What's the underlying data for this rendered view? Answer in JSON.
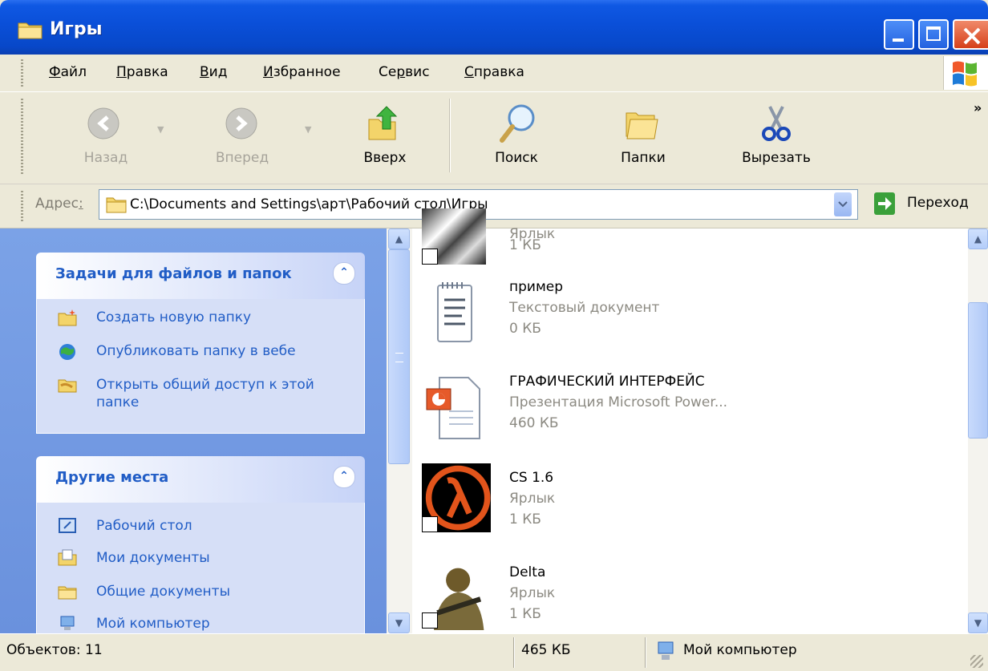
{
  "window": {
    "title": "Игры"
  },
  "menu": [
    {
      "hot": "Ф",
      "rest": "айл"
    },
    {
      "hot": "П",
      "rest": "равка"
    },
    {
      "hot": "В",
      "rest": "ид"
    },
    {
      "hot": "И",
      "rest": "збранное"
    },
    {
      "pre": "Се",
      "hot": "р",
      "rest": "вис"
    },
    {
      "hot": "С",
      "rest": "правка"
    }
  ],
  "toolbar": {
    "back": "Назад",
    "forward": "Вперед",
    "up": "Вверх",
    "search": "Поиск",
    "folders": "Папки",
    "cut": "Вырезать",
    "more": "»"
  },
  "address": {
    "label_pre": "Адрес",
    "label_hot": ":",
    "path": "C:\\Documents and Settings\\арт\\Рабочий стол\\Игры",
    "go": "Переход"
  },
  "tasks_panel": {
    "title": "Задачи для файлов и папок",
    "items": [
      {
        "label": "Создать новую папку",
        "icon": "new-folder-icon"
      },
      {
        "label": "Опубликовать папку в вебе",
        "icon": "publish-web-icon"
      },
      {
        "label": "Открыть общий доступ к этой папке",
        "icon": "share-folder-icon"
      }
    ]
  },
  "places_panel": {
    "title": "Другие места",
    "items": [
      {
        "label": "Рабочий стол",
        "icon": "desktop-icon"
      },
      {
        "label": "Мои документы",
        "icon": "my-documents-icon"
      },
      {
        "label": "Общие документы",
        "icon": "shared-documents-icon"
      },
      {
        "label": "Мой компьютер",
        "icon": "my-computer-icon"
      }
    ]
  },
  "files": [
    {
      "name": "",
      "type": "Ярлык",
      "size": "1 КБ",
      "icon": "game-shortcut-icon"
    },
    {
      "name": "пример",
      "type": "Текстовый документ",
      "size": "0 КБ",
      "icon": "text-document-icon"
    },
    {
      "name": "ГРАФИЧЕСКИЙ ИНТЕРФЕЙС",
      "type": "Презентация Microsoft Power...",
      "size": "460 КБ",
      "icon": "powerpoint-icon"
    },
    {
      "name": "CS 1.6",
      "type": "Ярлык",
      "size": "1 КБ",
      "icon": "half-life-icon"
    },
    {
      "name": "Delta",
      "type": "Ярлык",
      "size": "1 КБ",
      "icon": "delta-force-icon"
    }
  ],
  "status": {
    "objects": "Объектов: 11",
    "size": "465 КБ",
    "location": "Мой компьютер"
  },
  "colors": {
    "title_blue": "#0a4fd8",
    "task_link": "#215dc6",
    "panel_bg": "#d6dff7"
  }
}
